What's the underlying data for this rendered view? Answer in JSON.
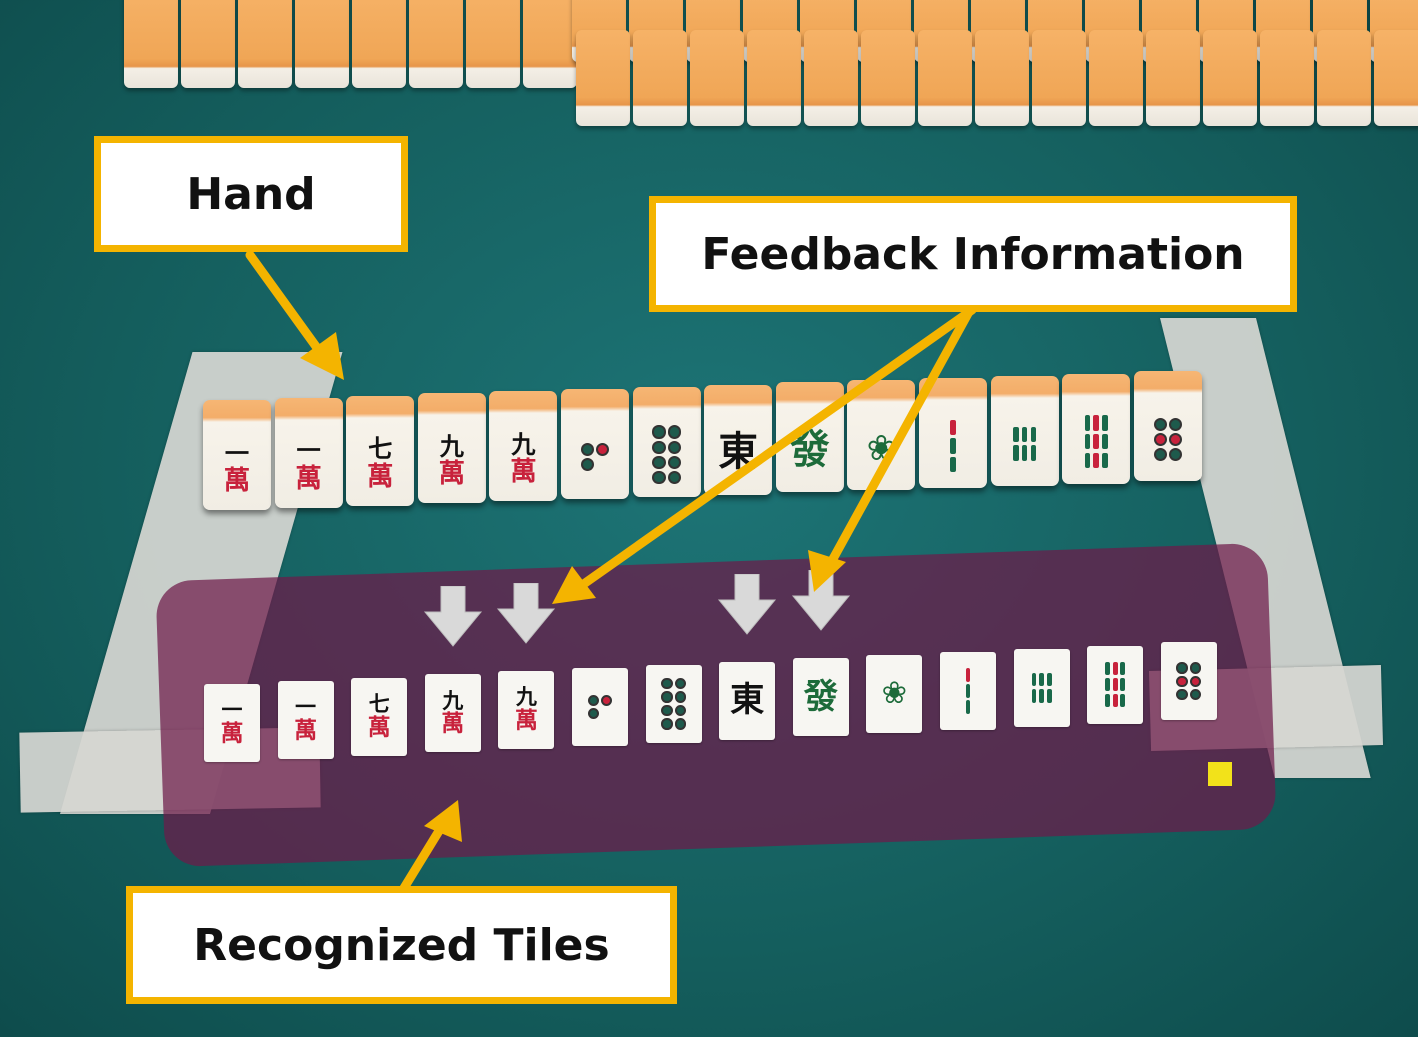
{
  "annotations": {
    "hand": "Hand",
    "feedback": "Feedback Information",
    "recognized": "Recognized Tiles"
  },
  "colors": {
    "table": "#15605f",
    "callout_border": "#f4b400",
    "overlay": "#6e1a4a",
    "marker": "#f2e21a",
    "wall_tile": "#f0a656"
  },
  "tiles": [
    {
      "name": "1-man",
      "top": "一",
      "bottom": "萬"
    },
    {
      "name": "1-man",
      "top": "一",
      "bottom": "萬"
    },
    {
      "name": "7-man",
      "top": "七",
      "bottom": "萬"
    },
    {
      "name": "9-man",
      "top": "九",
      "bottom": "萬"
    },
    {
      "name": "9-man",
      "top": "九",
      "bottom": "萬"
    },
    {
      "name": "3-pin",
      "suit": "pin",
      "count": 3
    },
    {
      "name": "8-pin",
      "suit": "pin",
      "count": 8
    },
    {
      "name": "east-wind",
      "honor": "東"
    },
    {
      "name": "green-dragon",
      "honor": "發"
    },
    {
      "name": "1-sou",
      "suit": "bird"
    },
    {
      "name": "3-sou",
      "suit": "sou",
      "count": 3
    },
    {
      "name": "6-sou",
      "suit": "sou",
      "count": 6
    },
    {
      "name": "9-sou",
      "suit": "sou",
      "count": 9
    },
    {
      "name": "6-pin",
      "suit": "pin",
      "count": 6
    }
  ],
  "feedback_arrow_tiles": [
    3,
    4,
    7,
    8
  ],
  "icons": [
    "down-arrow-icon",
    "annotation-arrow-icon",
    "status-marker-icon"
  ]
}
